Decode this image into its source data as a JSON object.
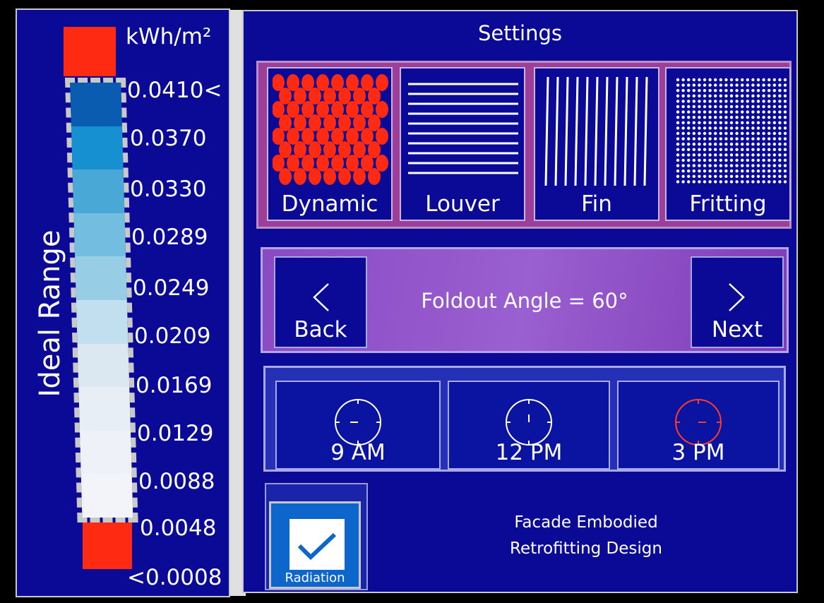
{
  "legend": {
    "unit": "kWh/m²",
    "title": "Ideal Range",
    "ticks": [
      "0.0410<",
      "0.0370",
      "0.0330",
      "0.0289",
      "0.0249",
      "0.0209",
      "0.0169",
      "0.0129",
      "0.0088",
      "0.0048",
      "<0.0008"
    ],
    "gradient_colors": [
      "#0a5cb0",
      "#1690d0",
      "#4aa8d6",
      "#72bde0",
      "#98cde6",
      "#c2dff0",
      "#dbe8f2",
      "#e8eef6",
      "#eef2f8",
      "#f2f4fa"
    ],
    "out_of_range_color": "#ff2a12"
  },
  "settings": {
    "title": "Settings",
    "types": [
      {
        "label": "Dynamic",
        "icon": "dynamic-pattern-icon"
      },
      {
        "label": "Louver",
        "icon": "louver-pattern-icon"
      },
      {
        "label": "Fin",
        "icon": "fin-pattern-icon"
      },
      {
        "label": "Fritting",
        "icon": "fritting-pattern-icon"
      }
    ],
    "angle_text": "Foldout Angle = 60°",
    "back_label": "Back",
    "next_label": "Next",
    "times": [
      {
        "label": "9 AM",
        "active": false
      },
      {
        "label": "12 PM",
        "active": false
      },
      {
        "label": "3 PM",
        "active": true
      }
    ],
    "radiation_label": "Radiation",
    "radiation_checked": true,
    "footer_line1": "Facade Embodied",
    "footer_line2": "Retrofitting Design"
  }
}
